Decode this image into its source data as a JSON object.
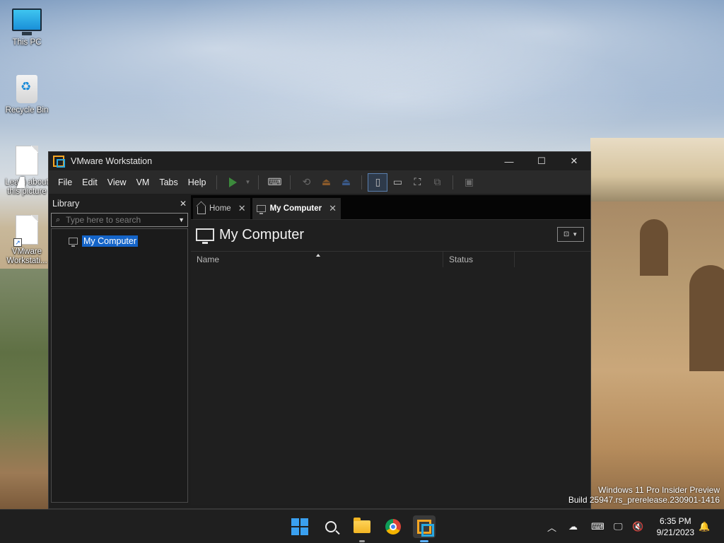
{
  "desktop": {
    "icons": [
      {
        "label": "This PC",
        "icon": "this-pc-icon"
      },
      {
        "label": "Recycle Bin",
        "icon": "recycle-bin-icon"
      },
      {
        "label": "Learn about this picture",
        "icon": "document-icon"
      },
      {
        "label": "VMware Workstati...",
        "icon": "shortcut-icon"
      }
    ],
    "watermark_line1": "Windows 11 Pro Insider Preview",
    "watermark_line2": "Build 25947.rs_prerelease.230901-1416"
  },
  "window": {
    "title": "VMware Workstation",
    "controls": {
      "minimize": "—",
      "maximize": "☐",
      "close": "✕"
    },
    "menu": [
      "File",
      "Edit",
      "View",
      "VM",
      "Tabs",
      "Help"
    ]
  },
  "library": {
    "title": "Library",
    "close": "✕",
    "search_placeholder": "Type here to search",
    "tree": [
      {
        "label": "My Computer"
      }
    ]
  },
  "tabs": [
    {
      "label": "Home",
      "close": "✕"
    },
    {
      "label": "My Computer",
      "close": "✕"
    }
  ],
  "content": {
    "title": "My Computer",
    "columns": [
      "Name",
      "Status"
    ]
  },
  "taskbar": {
    "apps": [
      "start",
      "search",
      "file-explorer",
      "chrome",
      "vmware-workstation"
    ],
    "clock_time": "6:35 PM",
    "clock_date": "9/21/2023",
    "accent": "#3aa0f0"
  }
}
